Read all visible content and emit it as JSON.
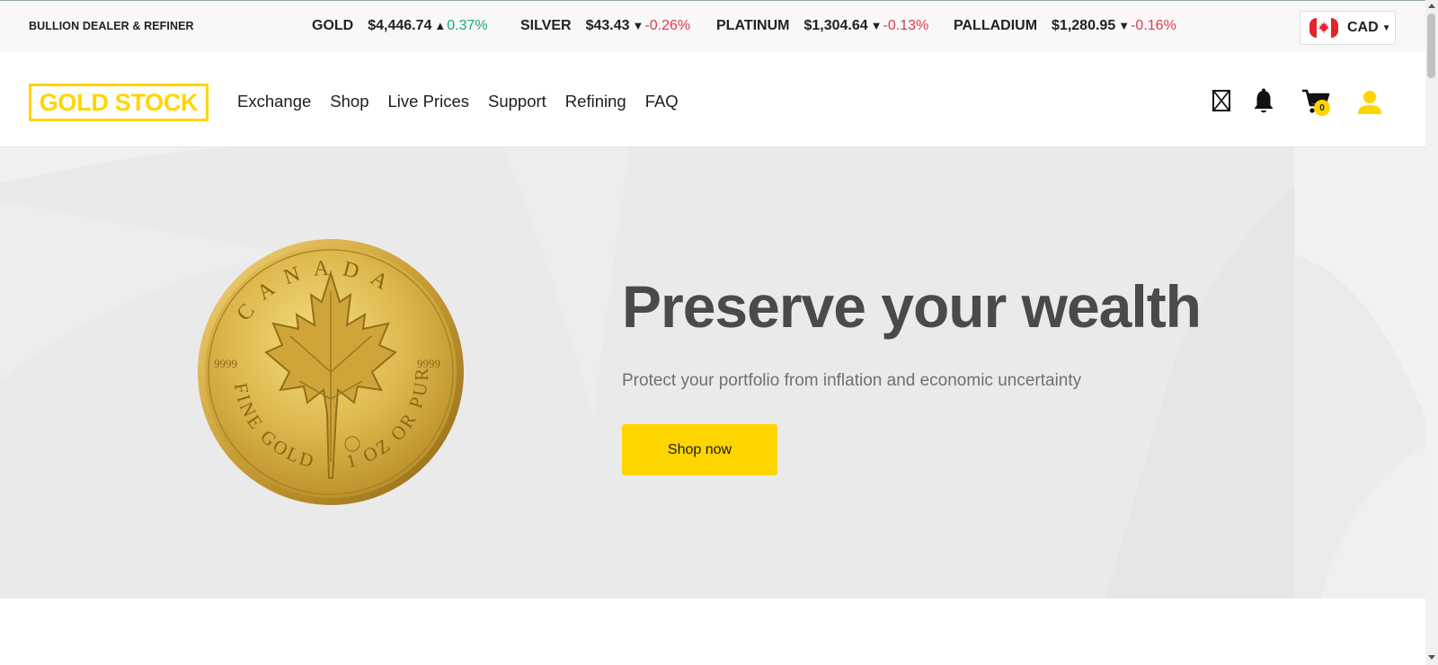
{
  "ticker": {
    "tagline": "BULLION DEALER & REFINER",
    "metals": [
      {
        "name": "GOLD",
        "price": "$4,446.74",
        "arrow": "▲",
        "change": "0.37%",
        "direction": "up"
      },
      {
        "name": "SILVER",
        "price": "$43.43",
        "arrow": "▼",
        "change": "-0.26%",
        "direction": "down"
      },
      {
        "name": "PLATINUM",
        "price": "$1,304.64",
        "arrow": "▼",
        "change": "-0.13%",
        "direction": "down"
      },
      {
        "name": "PALLADIUM",
        "price": "$1,280.95",
        "arrow": "▼",
        "change": "-0.16%",
        "direction": "down"
      }
    ],
    "currency": {
      "code": "CAD",
      "flag": "canada-flag-icon"
    }
  },
  "nav": {
    "logo": "GOLD STOCK",
    "menu": [
      "Exchange",
      "Shop",
      "Live Prices",
      "Support",
      "Refining",
      "FAQ"
    ],
    "icons": [
      "broken-image-icon",
      "bell-icon",
      "cart-icon",
      "user-icon"
    ],
    "cart_count": "0"
  },
  "hero": {
    "headline": "Preserve your wealth",
    "subline": "Protect your portfolio from inflation and economic uncertainty",
    "cta": "Shop now",
    "coin": {
      "top_text": "CANADA",
      "left_purity": "9999",
      "right_purity": "9999",
      "bottom_left": "FINE GOLD",
      "bottom_right": "1 OZ OR PUR"
    }
  },
  "colors": {
    "brand_yellow": "#ffd500",
    "up_green": "#19a971",
    "down_red": "#e0394b",
    "hero_bg": "#ebebeb",
    "headline": "#4a4a4a"
  }
}
